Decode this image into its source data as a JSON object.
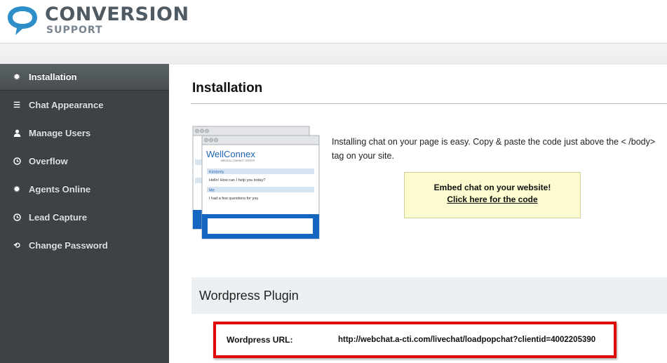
{
  "header": {
    "logo_title": "CONVERSION",
    "logo_subtitle": "SUPPORT",
    "accent_color": "#2e8fc8"
  },
  "sidebar": {
    "items": [
      {
        "label": "Installation",
        "icon": "gear-icon",
        "active": true
      },
      {
        "label": "Chat Appearance",
        "icon": "list-icon",
        "active": false
      },
      {
        "label": "Manage Users",
        "icon": "user-icon",
        "active": false
      },
      {
        "label": "Overflow",
        "icon": "clock-icon",
        "active": false
      },
      {
        "label": "Agents Online",
        "icon": "gear-icon",
        "active": false
      },
      {
        "label": "Lead Capture",
        "icon": "clock-icon",
        "active": false
      },
      {
        "label": "Change Password",
        "icon": "refresh-icon",
        "active": false
      }
    ]
  },
  "main": {
    "title": "Installation",
    "intro_text": "Installing chat on your page is easy. Copy & paste the code just above the < /body> tag on your site.",
    "embed": {
      "line1": "Embed chat on your website!",
      "link": "Click here for the code"
    },
    "preview": {
      "brand": "WellConnex",
      "brand_sub": "MEDICAL CONTACT CENTER",
      "msg1_name": "Kimberly",
      "msg1_text": "Hello! How can I help you today?",
      "msg2_name": "Me",
      "msg2_text": "I had a few quesitons for you"
    },
    "wordpress": {
      "section_title": "Wordpress Plugin",
      "url_label": "Wordpress URL:",
      "url_value": "http://webchat.a-cti.com/livechat/loadpopchat?clientid=4002205390"
    }
  }
}
